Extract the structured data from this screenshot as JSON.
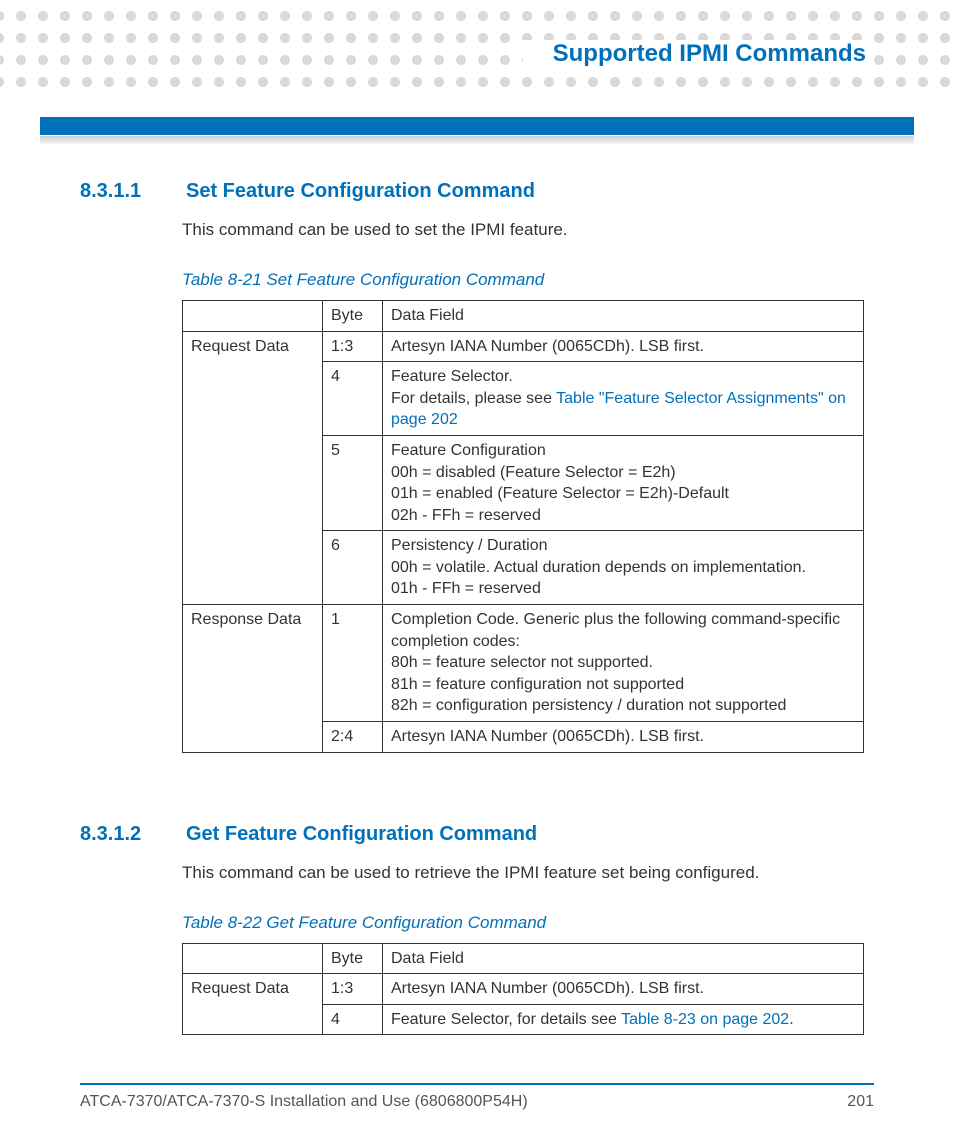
{
  "header": {
    "title": "Supported IPMI Commands"
  },
  "section1": {
    "num": "8.3.1.1",
    "title": "Set Feature Configuration Command",
    "intro": "This command can be used to set the IPMI feature.",
    "table_caption": "Table 8-21 Set Feature Configuration Command",
    "headers": {
      "byte": "Byte",
      "data_field": "Data Field"
    },
    "request_label": "Request Data",
    "response_label": "Response Data",
    "req_rows": [
      {
        "byte": "1:3",
        "text": "Artesyn IANA Number (0065CDh). LSB first."
      },
      {
        "byte": "4",
        "pre": "Feature Selector.\nFor details, please see ",
        "link": "Table \"Feature Selector Assignments\" on page 202"
      },
      {
        "byte": "5",
        "text": "Feature Configuration\n00h = disabled (Feature Selector = E2h)\n01h = enabled (Feature Selector = E2h)-Default\n02h - FFh = reserved"
      },
      {
        "byte": "6",
        "text": "Persistency / Duration\n00h = volatile. Actual duration depends on implementation.\n01h - FFh = reserved"
      }
    ],
    "resp_rows": [
      {
        "byte": "1",
        "text": "Completion Code. Generic plus the following command-specific completion codes:\n80h = feature selector not supported.\n81h = feature configuration not supported\n82h = configuration persistency / duration not supported"
      },
      {
        "byte": "2:4",
        "text": "Artesyn IANA Number (0065CDh). LSB first."
      }
    ]
  },
  "section2": {
    "num": "8.3.1.2",
    "title": "Get Feature Configuration Command",
    "intro": "This command can be used to retrieve the IPMI feature set being configured.",
    "table_caption": "Table 8-22 Get Feature Configuration Command",
    "headers": {
      "byte": "Byte",
      "data_field": "Data Field"
    },
    "request_label": "Request Data",
    "req_rows": [
      {
        "byte": "1:3",
        "text": "Artesyn IANA Number (0065CDh). LSB first."
      },
      {
        "byte": "4",
        "pre": "Feature Selector, for details see ",
        "link": "Table 8-23 on page 202",
        "post": "."
      }
    ]
  },
  "footer": {
    "left": "ATCA-7370/ATCA-7370-S Installation and Use (6806800P54H)",
    "right": "201"
  }
}
